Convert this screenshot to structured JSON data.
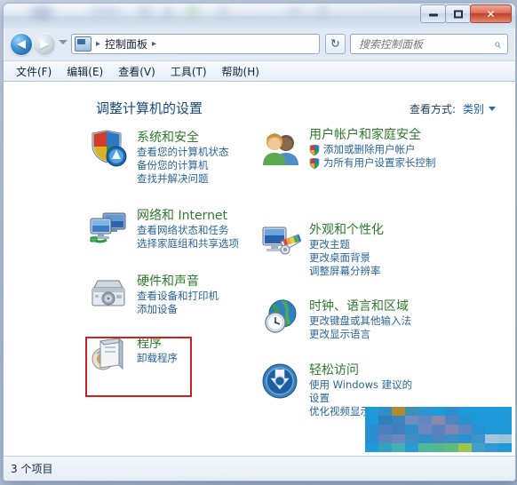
{
  "window": {
    "buttons": {
      "minimize": "minimize",
      "maximize": "maximize",
      "close": "✕"
    }
  },
  "navbar": {
    "back_glyph": "◀",
    "forward_glyph": "▶",
    "breadcrumb": [
      "控制面板"
    ],
    "crumb_separator": "▸",
    "refresh_glyph": "↻",
    "search_placeholder": "搜索控制面板",
    "search_value": "",
    "search_icon": "⌕"
  },
  "menubar": {
    "items": [
      "文件(F)",
      "编辑(E)",
      "查看(V)",
      "工具(T)",
      "帮助(H)"
    ]
  },
  "content": {
    "page_title": "调整计算机的设置",
    "view_by_label": "查看方式:",
    "view_by_value": "类别"
  },
  "categories_left": [
    {
      "icon": "security-shield-icon",
      "title": "系统和安全",
      "links": [
        {
          "text": "查看您的计算机状态",
          "shield": false
        },
        {
          "text": "备份您的计算机",
          "shield": false
        },
        {
          "text": "查找并解决问题",
          "shield": false
        }
      ]
    },
    {
      "icon": "network-internet-icon",
      "title": "网络和 Internet",
      "links": [
        {
          "text": "查看网络状态和任务",
          "shield": false
        },
        {
          "text": "选择家庭组和共享选项",
          "shield": false
        }
      ]
    },
    {
      "icon": "hardware-sound-icon",
      "title": "硬件和声音",
      "links": [
        {
          "text": "查看设备和打印机",
          "shield": false
        },
        {
          "text": "添加设备",
          "shield": false
        }
      ]
    },
    {
      "icon": "programs-icon",
      "title": "程序",
      "links": [
        {
          "text": "卸载程序",
          "shield": false
        }
      ]
    }
  ],
  "categories_right": [
    {
      "icon": "user-accounts-icon",
      "title": "用户帐户和家庭安全",
      "links": [
        {
          "text": "添加或删除用户帐户",
          "shield": true
        },
        {
          "text": "为所有用户设置家长控制",
          "shield": true
        }
      ]
    },
    {
      "icon": "appearance-personalization-icon",
      "title": "外观和个性化",
      "links": [
        {
          "text": "更改主题",
          "shield": false
        },
        {
          "text": "更改桌面背景",
          "shield": false
        },
        {
          "text": "调整屏幕分辨率",
          "shield": false
        }
      ]
    },
    {
      "icon": "clock-language-region-icon",
      "title": "时钟、语言和区域",
      "links": [
        {
          "text": "更改键盘或其他输入法",
          "shield": false
        },
        {
          "text": "更改显示语言",
          "shield": false
        }
      ]
    },
    {
      "icon": "ease-of-access-icon",
      "title": "轻松访问",
      "links": [
        {
          "text": "使用 Windows 建议的设置",
          "shield": false
        },
        {
          "text": "优化视频显示",
          "shield": false
        }
      ]
    }
  ],
  "highlight": {
    "target": "程序",
    "color": "#d02020"
  },
  "statusbar": {
    "text": "3 个项目"
  },
  "colors": {
    "category_title": "#2c7a2c",
    "category_link": "#2a6496",
    "page_title": "#17497a",
    "highlight": "#d02020",
    "mosaic_base": "#1399d6"
  }
}
